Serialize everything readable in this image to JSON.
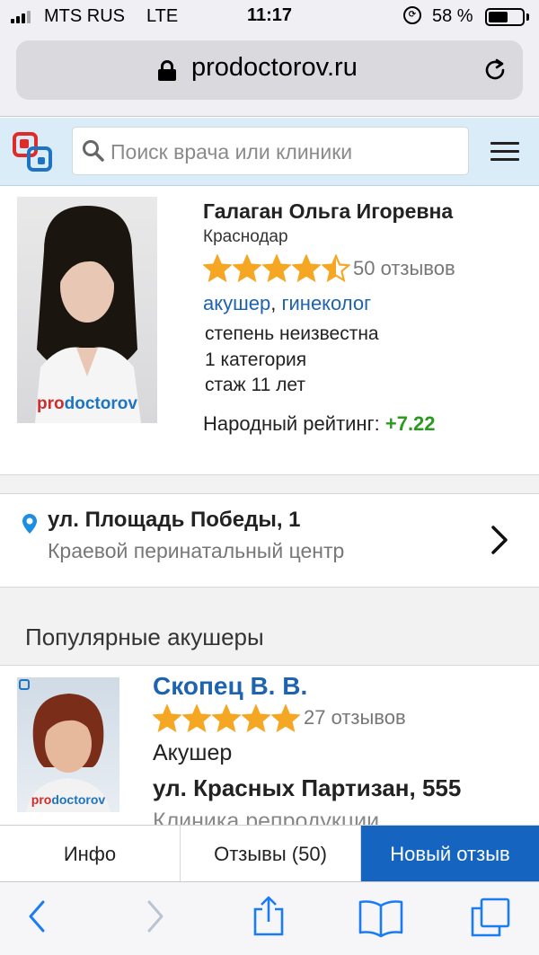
{
  "status_bar": {
    "carrier": "MTS RUS",
    "network": "LTE",
    "time": "11:17",
    "battery_percent": "58 %",
    "battery_level": 0.58
  },
  "browser": {
    "url": "prodoctorov.ru"
  },
  "header": {
    "search_placeholder": "Поиск врача или клиники"
  },
  "doctor": {
    "name": "Галаган Ольга Игоревна",
    "city": "Краснодар",
    "rating_stars": 4.5,
    "reviews": "50 отзывов",
    "specialties": [
      "акушер",
      "гинеколог"
    ],
    "specialty_separator": ",",
    "degree": "степень неизвестна",
    "category": "1 категория",
    "experience": "стаж 11 лет",
    "rating_label": "Народный рейтинг:",
    "rating_value": "+7.22",
    "photo_watermark_pro": "pro",
    "photo_watermark_doc": "doctorov"
  },
  "address": {
    "street": "ул. Площадь Победы, 1",
    "clinic": "Краевой перинатальный центр"
  },
  "popular": {
    "title": "Популярные акушеры",
    "doctor": {
      "name": "Скопец В. В.",
      "rating_stars": 5,
      "reviews": "27 отзывов",
      "specialty": "Акушер",
      "address": "ул. Красных Партизан, 555",
      "clinic": "Клиника репродукции"
    }
  },
  "tabs": {
    "info": "Инфо",
    "reviews": "Отзывы (50)",
    "new_review": "Новый отзыв"
  },
  "colors": {
    "star": "#f5a623",
    "link": "#1d63b0",
    "accent": "#1565c0",
    "rating_positive": "#2b9a1f",
    "header_bg": "#d9ecf8"
  }
}
